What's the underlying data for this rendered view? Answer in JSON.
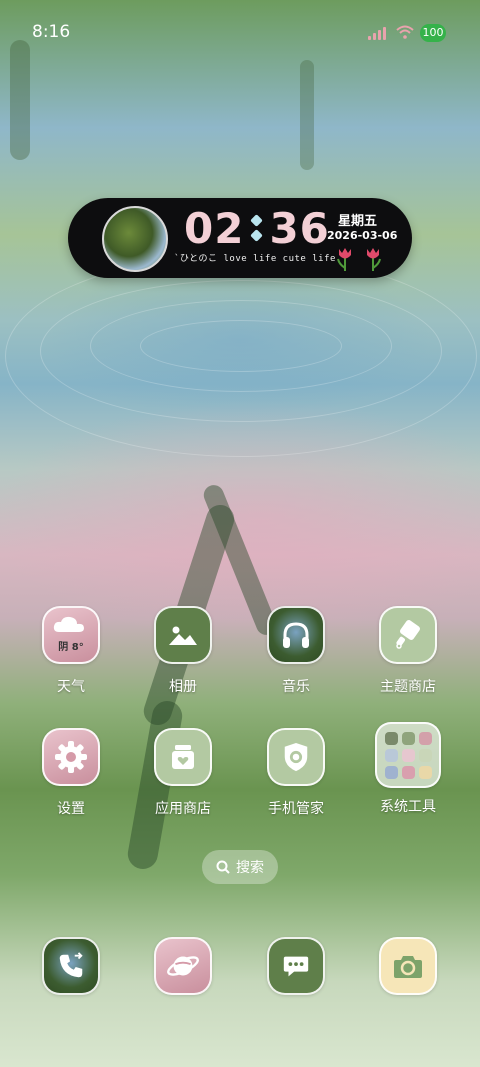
{
  "status_bar": {
    "time": "8:16",
    "battery": "100",
    "battery_color": "#35b24a",
    "signal_color": "#e9a3ad"
  },
  "clock_widget": {
    "hours": "02",
    "minutes": "36",
    "weekday": "星期五",
    "date": "2026-03-06",
    "motto": "`ひとのこ love life cute life",
    "time_color": "#f3d0d6",
    "separator_color": "#b9e4ef",
    "icons": [
      "photo-avatar",
      "tulip-icon",
      "tulip-icon"
    ]
  },
  "apps": [
    {
      "label": "天气",
      "icon": "weather-icon",
      "badge_text": "阴 8°"
    },
    {
      "label": "相册",
      "icon": "mountain-photo-icon"
    },
    {
      "label": "音乐",
      "icon": "headphones-icon"
    },
    {
      "label": "主题商店",
      "icon": "paint-brush-icon"
    },
    {
      "label": "设置",
      "icon": "gear-icon"
    },
    {
      "label": "应用商店",
      "icon": "store-bag-icon"
    },
    {
      "label": "手机管家",
      "icon": "shield-icon"
    },
    {
      "label": "系统工具",
      "icon": "folder-icon"
    }
  ],
  "search": {
    "label": "搜索",
    "icon": "search-icon"
  },
  "dock": [
    {
      "icon": "phone-icon"
    },
    {
      "icon": "planet-browser-icon"
    },
    {
      "icon": "message-icon"
    },
    {
      "icon": "camera-icon"
    }
  ]
}
